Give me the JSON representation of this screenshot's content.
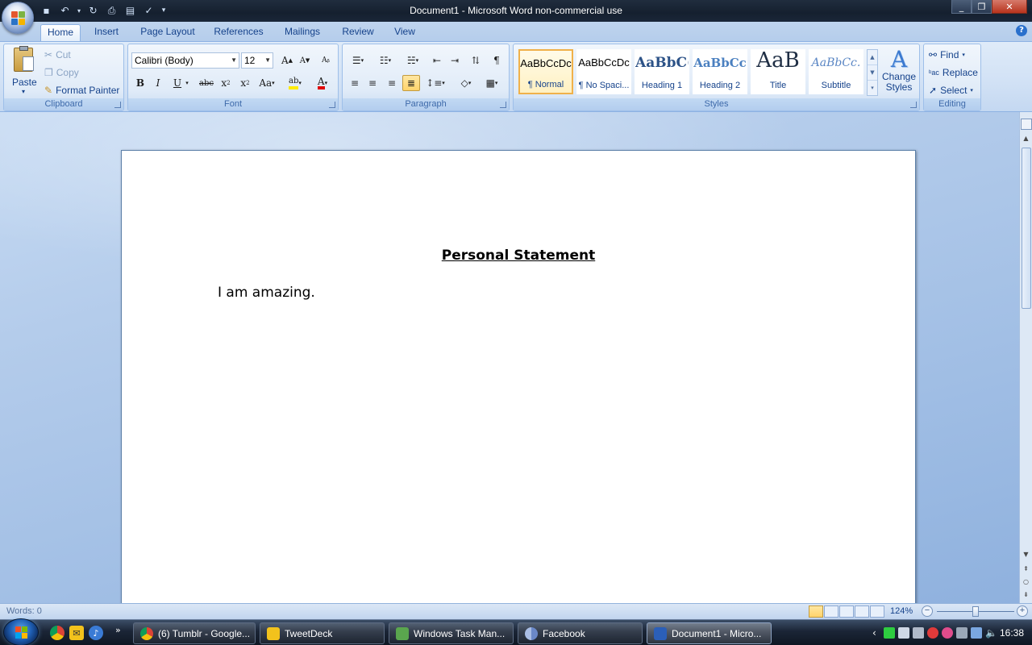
{
  "window": {
    "title": "Document1 - Microsoft Word non-commercial use"
  },
  "tabs": [
    "Home",
    "Insert",
    "Page Layout",
    "References",
    "Mailings",
    "Review",
    "View"
  ],
  "ribbon": {
    "clipboard": {
      "label": "Clipboard",
      "paste": "Paste",
      "cut": "Cut",
      "copy": "Copy",
      "format_painter": "Format Painter"
    },
    "font": {
      "label": "Font",
      "font_name": "Calibri (Body)",
      "font_size": "12"
    },
    "paragraph": {
      "label": "Paragraph"
    },
    "styles": {
      "label": "Styles",
      "change_styles": "Change Styles",
      "items": [
        {
          "preview": "AaBbCcDc",
          "name": "¶ Normal"
        },
        {
          "preview": "AaBbCcDc",
          "name": "¶ No Spaci..."
        },
        {
          "preview": "AaBbC(",
          "name": "Heading 1"
        },
        {
          "preview": "AaBbCc",
          "name": "Heading 2"
        },
        {
          "preview": "AaB",
          "name": "Title"
        },
        {
          "preview": "AaBbCc.",
          "name": "Subtitle"
        }
      ]
    },
    "editing": {
      "label": "Editing",
      "find": "Find",
      "replace": "Replace",
      "select": "Select"
    }
  },
  "document": {
    "title": "Personal Statement",
    "body": "I am amazing."
  },
  "statusbar": {
    "words": "Words: 0",
    "zoom": "124%",
    "zoom_level": 0.5
  },
  "taskbar": {
    "tasks": [
      {
        "label": "(6) Tumblr - Google...",
        "color": "#e8a22a"
      },
      {
        "label": "TweetDeck",
        "color": "#f2c21c"
      },
      {
        "label": "Windows Task Man...",
        "color": "#5aa64e"
      },
      {
        "label": "Facebook",
        "color": "#6a88c8"
      },
      {
        "label": "Document1 - Micro...",
        "color": "#2b5fb8"
      }
    ],
    "clock": "16:38"
  },
  "colors": {
    "accent": "#15428b",
    "selected_style": "#f0b14a",
    "ribbon_bg": "#dfebf9"
  }
}
